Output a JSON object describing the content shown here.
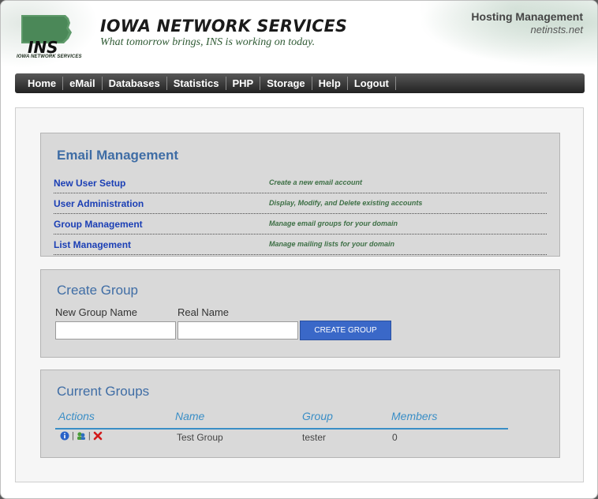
{
  "header": {
    "logo_text": "INS",
    "logo_subtext": "IOWA NETWORK SERVICES",
    "brand": "IOWA NETWORK SERVICES",
    "tagline": "What tomorrow brings, INS is working on today.",
    "hosting_label": "Hosting Management",
    "domain": "netinsts.net"
  },
  "nav": {
    "items": [
      "Home",
      "eMail",
      "Databases",
      "Statistics",
      "PHP",
      "Storage",
      "Help",
      "Logout"
    ]
  },
  "email_management": {
    "title": "Email Management",
    "rows": [
      {
        "link": "New User Setup",
        "desc": "Create a new email account"
      },
      {
        "link": "User Administration",
        "desc": "Display, Modify, and Delete existing accounts"
      },
      {
        "link": "Group Management",
        "desc": "Manage email groups for your domain"
      },
      {
        "link": "List Management",
        "desc": "Manage mailing lists for your domain"
      }
    ]
  },
  "create_group": {
    "title": "Create Group",
    "group_name_label": "New Group Name",
    "real_name_label": "Real Name",
    "group_name_value": "",
    "real_name_value": "",
    "button_label": "CREATE GROUP"
  },
  "current_groups": {
    "title": "Current Groups",
    "columns": [
      "Actions",
      "Name",
      "Group",
      "Members"
    ],
    "rows": [
      {
        "name": "Test Group",
        "group": "tester",
        "members": "0",
        "separator": "|"
      }
    ]
  },
  "colors": {
    "accent_blue": "#3f6da5",
    "link_blue": "#1b3fb5",
    "button_blue": "#3a68c8",
    "desc_green": "#3d6f45",
    "header_line": "#3a8ec6"
  },
  "icons": [
    "info-icon",
    "group-edit-icon",
    "delete-icon"
  ]
}
